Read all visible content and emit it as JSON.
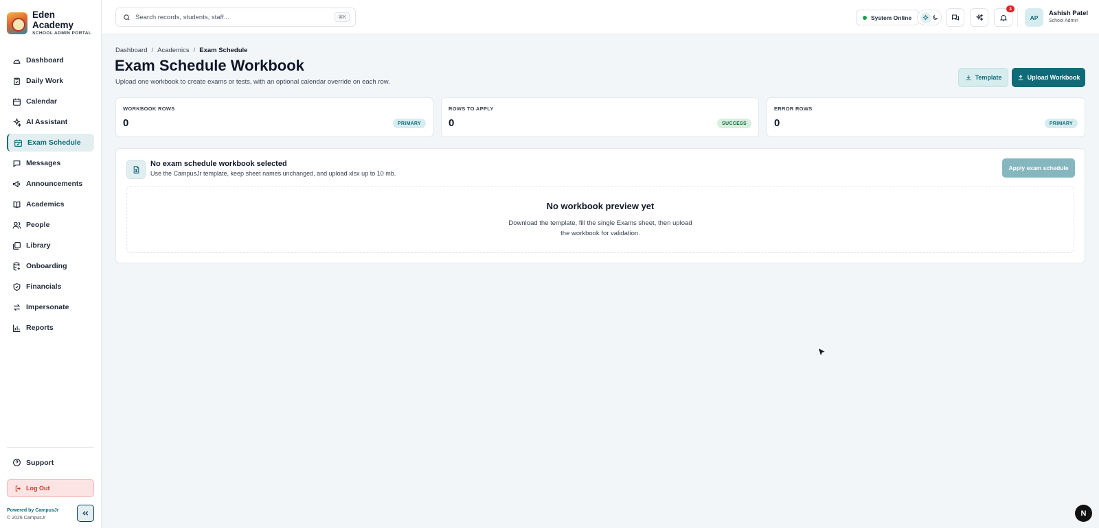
{
  "brand": {
    "name": "Eden Academy",
    "subtitle": "SCHOOL ADMIN PORTAL"
  },
  "sidebar": {
    "items": [
      {
        "label": "Dashboard",
        "icon": "dashboard-icon"
      },
      {
        "label": "Daily Work",
        "icon": "clipboard-icon"
      },
      {
        "label": "Calendar",
        "icon": "calendar-icon"
      },
      {
        "label": "AI Assistant",
        "icon": "sparkles-icon"
      },
      {
        "label": "Exam Schedule",
        "icon": "calendar-check-icon",
        "active": true
      },
      {
        "label": "Messages",
        "icon": "message-icon"
      },
      {
        "label": "Announcements",
        "icon": "megaphone-icon"
      },
      {
        "label": "Academics",
        "icon": "book-icon"
      },
      {
        "label": "People",
        "icon": "users-icon"
      },
      {
        "label": "Library",
        "icon": "library-icon"
      },
      {
        "label": "Onboarding",
        "icon": "database-icon"
      },
      {
        "label": "Financials",
        "icon": "shield-icon"
      },
      {
        "label": "Impersonate",
        "icon": "swap-icon"
      },
      {
        "label": "Reports",
        "icon": "bar-chart-icon"
      }
    ],
    "support_label": "Support",
    "logout_label": "Log Out",
    "powered_by": "Powered by CampusJr",
    "copyright": "© 2026 CampusJr"
  },
  "topbar": {
    "search_placeholder": "Search records, students, staff...",
    "search_shortcut": "⌘K",
    "status": "System Online",
    "notification_count": "3",
    "user": {
      "initials": "AP",
      "name": "Ashish Patel",
      "role": "School Admin"
    }
  },
  "breadcrumb": [
    "Dashboard",
    "Academics",
    "Exam Schedule"
  ],
  "page": {
    "title": "Exam Schedule Workbook",
    "subtitle": "Upload one workbook to create exams or tests, with an optional calendar override on each row.",
    "template_label": "Template",
    "upload_label": "Upload Workbook"
  },
  "stats": [
    {
      "label": "WORKBOOK ROWS",
      "value": "0",
      "tag": "PRIMARY"
    },
    {
      "label": "ROWS TO APPLY",
      "value": "0",
      "tag": "SUCCESS"
    },
    {
      "label": "ERROR ROWS",
      "value": "0",
      "tag": "PRIMARY"
    }
  ],
  "panel": {
    "title": "No exam schedule workbook selected",
    "subtitle": "Use the CampusJr template, keep sheet names unchanged, and upload xlsx up to 10 mb.",
    "apply_label": "Apply exam schedule",
    "empty_title": "No workbook preview yet",
    "empty_text": "Download the template, fill the single Exams sheet, then upload the workbook for validation."
  },
  "dev_badge": "N",
  "colors": {
    "accent": "#0f6b78",
    "accent_light": "#d7ecef",
    "danger": "#dc2626",
    "success": "#16a34a"
  }
}
